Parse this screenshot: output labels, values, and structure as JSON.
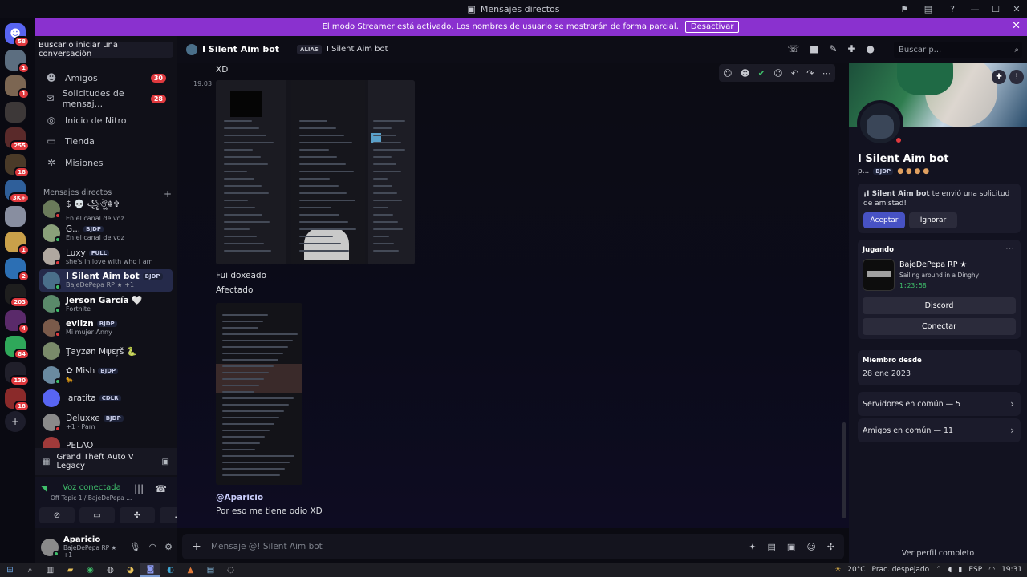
{
  "window": {
    "title": "Mensajes directos",
    "title_icon": "discord-icon"
  },
  "banner": {
    "text": "El modo Streamer está activado. Los nombres de usuario se mostrarán de forma parcial.",
    "button": "Desactivar"
  },
  "servers": [
    {
      "badge": "58",
      "color": "#5865f2"
    },
    {
      "badge": "1",
      "color": "#5c6e80"
    },
    {
      "badge": "1",
      "color": "#7c6652"
    },
    {
      "badge": "",
      "color": "#3d3838"
    },
    {
      "badge": "255",
      "color": "#5a2a2a"
    },
    {
      "badge": "18",
      "color": "#4a3a28"
    },
    {
      "badge": "3K+",
      "color": "#2f5f9a"
    },
    {
      "badge": "",
      "color": "#888ea0"
    },
    {
      "badge": "1",
      "color": "#c9a04a"
    },
    {
      "badge": "2",
      "color": "#2c6fb4"
    },
    {
      "badge": "203",
      "color": "#1e1e1e"
    },
    {
      "badge": "4",
      "color": "#5a2a6a"
    },
    {
      "badge": "84",
      "color": "#2fa85a"
    },
    {
      "badge": "130",
      "color": "#201f2a"
    },
    {
      "badge": "18",
      "color": "#8a2a2a"
    }
  ],
  "sidebar": {
    "search": "Buscar o iniciar una conversación",
    "nav": [
      {
        "label": "Amigos",
        "count": "30",
        "icon": "friends-icon"
      },
      {
        "label": "Solicitudes de mensaj...",
        "count": "28",
        "icon": "message-requests-icon"
      },
      {
        "label": "Inicio de Nitro",
        "count": "",
        "icon": "nitro-icon"
      },
      {
        "label": "Tienda",
        "count": "",
        "icon": "shop-icon"
      },
      {
        "label": "Misiones",
        "count": "",
        "icon": "quests-icon"
      }
    ],
    "dm_header": "Mensajes directos",
    "dms": [
      {
        "name": "$ 💀 ꧁ঔৣ☬✞",
        "tag": "",
        "sub": "En el canal de voz",
        "color": "#6a7a5a",
        "status": "#e0393e"
      },
      {
        "name": "G...",
        "tag": "BJDP",
        "sub": "En el canal de voz",
        "color": "#8aa07a",
        "status": "#3fbf6b"
      },
      {
        "name": "Luxy",
        "tag": "FULL",
        "sub": "she's in love with who I am",
        "color": "#b0a8a0",
        "status": "#e0393e"
      },
      {
        "name": "I Silent Aim bot",
        "tag": "BJDP",
        "sub": "BajeDePepa RP ★ +1",
        "color": "#4a6f8a",
        "status": "#3fbf6b"
      },
      {
        "name": "Jerson García 🤍",
        "tag": "",
        "sub": "Fortnite",
        "color": "#5a8a6a",
        "status": "#3fbf6b"
      },
      {
        "name": "evilzn",
        "tag": "BJDP",
        "sub": "Mi mujer Anny",
        "color": "#7a5a4a",
        "status": "#e0393e"
      },
      {
        "name": "Ţayzøn Μψεŗš 🐍",
        "tag": "",
        "sub": "",
        "color": "#7a8a6a",
        "status": ""
      },
      {
        "name": "✿ Mish",
        "tag": "BJDP",
        "sub": "🐆",
        "color": "#6a8aa0",
        "status": "#3fbf6b"
      },
      {
        "name": "laratita",
        "tag": "CDLR",
        "sub": "",
        "color": "#5865f2",
        "status": ""
      },
      {
        "name": "Deluxxe",
        "tag": "BJDP",
        "sub": "+1 · Pam",
        "color": "#8a8a8a",
        "status": "#e0393e"
      },
      {
        "name": "PELAO",
        "tag": "",
        "sub": "",
        "color": "#a03a3a",
        "status": ""
      }
    ],
    "game": "Grand Theft Auto V Legacy",
    "voice_title": "Voz conectada",
    "voice_sub": "Off Topic 1 / BajeDePepa ...",
    "user_name": "Aparicio",
    "user_sub": "BajeDePepa RP ★ +1"
  },
  "chat": {
    "name": "I Silent Aim bot",
    "alias_label": "ALIAS",
    "alias_value": "I Silent Aim bot",
    "search_placeholder": "Buscar p...",
    "messages": {
      "xd": "XD",
      "time": "19:03",
      "doxeado": "Fui doxeado",
      "afectado": "Afectado",
      "mention": "@Aparicio",
      "last": "Por eso me tiene odio XD"
    },
    "composer_placeholder": "Mensaje @! Silent Aim bot"
  },
  "profile": {
    "name": "I Silent Aim bot",
    "sub_prefix": "p...",
    "sub_tag": "BJDP",
    "request_name": "¡I Silent Aim bot",
    "request_text": "te envió una solicitud de amistad!",
    "accept": "Aceptar",
    "ignore": "Ignorar",
    "activity_label": "Jugando",
    "activity_title": "BajeDePepa RP ★",
    "activity_sub": "Sailing around in a Dinghy",
    "activity_time": "1:23:58",
    "btn_discord": "Discord",
    "btn_connect": "Conectar",
    "member_label": "Miembro desde",
    "member_date": "28 ene 2023",
    "servers_common": "Servidores en común — 5",
    "friends_common": "Amigos en común — 11",
    "full_profile": "Ver perfil completo"
  },
  "taskbar": {
    "weather": "20°C",
    "weather_desc": "Prac. despejado",
    "lang": "ESP",
    "time": "19:31"
  }
}
